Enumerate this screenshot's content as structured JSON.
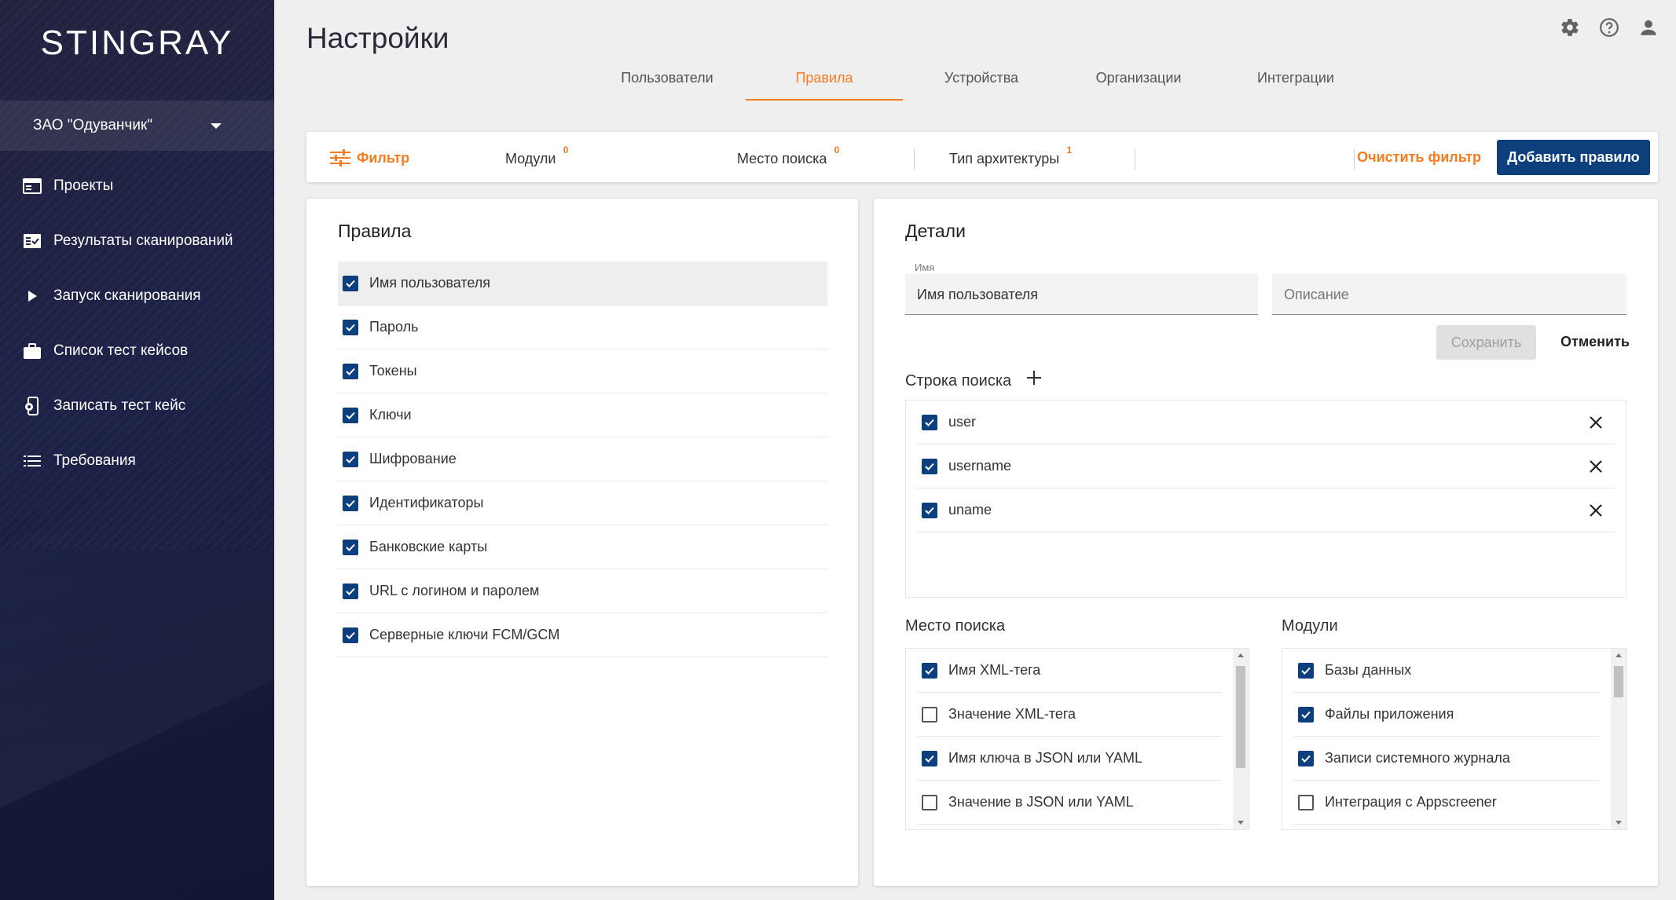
{
  "brand": {
    "logo": "STINGRAY",
    "org": "ЗАО \"Одуванчик\""
  },
  "sidebar": {
    "items": [
      {
        "label": "Проекты",
        "icon": "projects-icon"
      },
      {
        "label": "Результаты сканирований",
        "icon": "scan-results-icon"
      },
      {
        "label": "Запуск сканирования",
        "icon": "play-icon"
      },
      {
        "label": "Список тест кейсов",
        "icon": "briefcase-icon"
      },
      {
        "label": "Записать тест кейс",
        "icon": "record-icon"
      },
      {
        "label": "Требования",
        "icon": "list-icon"
      }
    ]
  },
  "header": {
    "title": "Настройки"
  },
  "tabs": [
    {
      "label": "Пользователи",
      "active": false
    },
    {
      "label": "Правила",
      "active": true
    },
    {
      "label": "Устройства",
      "active": false
    },
    {
      "label": "Организации",
      "active": false
    },
    {
      "label": "Интеграции",
      "active": false
    }
  ],
  "filter": {
    "label": "Фильтр",
    "groups": [
      {
        "label": "Модули",
        "count": "0"
      },
      {
        "label": "Место поиска",
        "count": "0"
      },
      {
        "label": "Тип архитектуры",
        "count": "1"
      }
    ],
    "clear_label": "Очистить фильтр",
    "add_label": "Добавить правило"
  },
  "rules": {
    "title": "Правила",
    "items": [
      {
        "label": "Имя пользователя",
        "checked": true,
        "selected": true
      },
      {
        "label": "Пароль",
        "checked": true
      },
      {
        "label": "Токены",
        "checked": true
      },
      {
        "label": "Ключи",
        "checked": true
      },
      {
        "label": "Шифрование",
        "checked": true
      },
      {
        "label": "Идентификаторы",
        "checked": true
      },
      {
        "label": "Банковские карты",
        "checked": true
      },
      {
        "label": "URL с логином и паролем",
        "checked": true
      },
      {
        "label": "Серверные ключи FCM/GCM",
        "checked": true
      }
    ]
  },
  "details": {
    "title": "Детали",
    "name_label": "Имя",
    "name_value": "Имя пользователя",
    "description_placeholder": "Описание",
    "save_label": "Сохранить",
    "cancel_label": "Отменить",
    "search_string_title": "Строка поиска",
    "search_strings": [
      {
        "value": "user",
        "checked": true
      },
      {
        "value": "username",
        "checked": true
      },
      {
        "value": "uname",
        "checked": true
      }
    ],
    "locations_title": "Место поиска",
    "locations": [
      {
        "label": "Имя XML-тега",
        "checked": true
      },
      {
        "label": "Значение XML-тега",
        "checked": false
      },
      {
        "label": "Имя ключа в JSON или YAML",
        "checked": true
      },
      {
        "label": "Значение в JSON или YAML",
        "checked": false
      }
    ],
    "modules_title": "Модули",
    "modules": [
      {
        "label": "Базы данных",
        "checked": true
      },
      {
        "label": "Файлы приложения",
        "checked": true
      },
      {
        "label": "Записи системного журнала",
        "checked": true
      },
      {
        "label": "Интеграция с Appscreener",
        "checked": false
      }
    ]
  },
  "colors": {
    "accent": "#f47b20",
    "primary": "#0d3f7d",
    "sidebar": "#1d2247"
  }
}
